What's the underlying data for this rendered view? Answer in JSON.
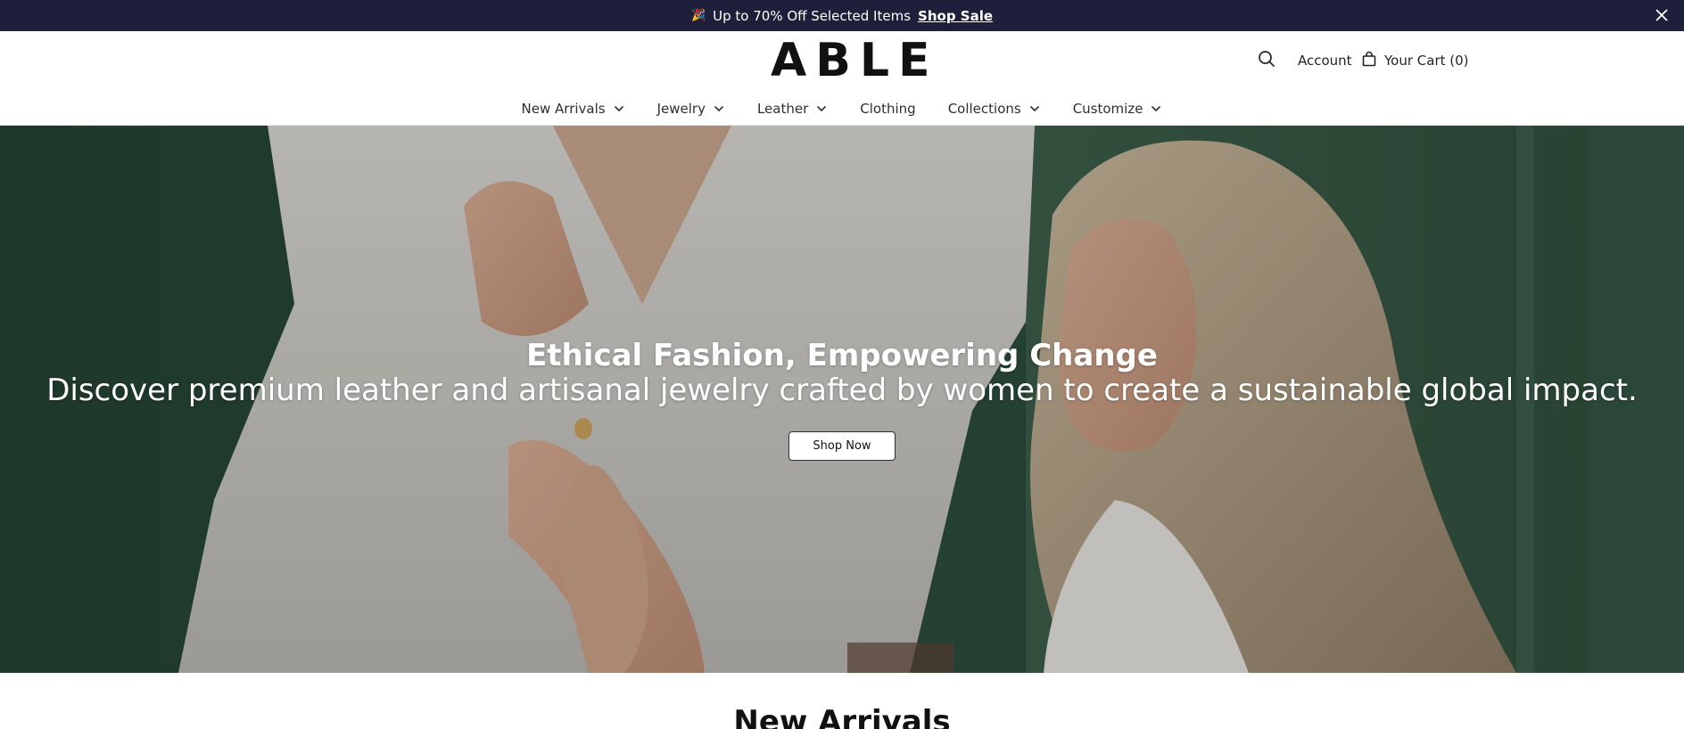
{
  "announcement": {
    "emoji": "🎉",
    "text": "Up to 70% Off Selected Items",
    "link_label": "Shop Sale"
  },
  "header": {
    "logo": "ABLE",
    "account_label": "Account",
    "cart_label": "Your Cart (0)"
  },
  "nav": {
    "items": [
      {
        "label": "New Arrivals",
        "has_dropdown": true
      },
      {
        "label": "Jewelry",
        "has_dropdown": true
      },
      {
        "label": "Leather",
        "has_dropdown": true
      },
      {
        "label": "Clothing",
        "has_dropdown": false
      },
      {
        "label": "Collections",
        "has_dropdown": true
      },
      {
        "label": "Customize",
        "has_dropdown": true
      }
    ]
  },
  "hero": {
    "title": "Ethical Fashion, Empowering Change",
    "subtitle": "Discover premium leather and artisanal jewelry crafted by women to create a sustainable global impact.",
    "cta_label": "Shop Now"
  },
  "sections": {
    "new_arrivals_title": "New Arrivals"
  },
  "colors": {
    "announcement_bg": "#1e1f3b",
    "hero_green": "#3a5a44",
    "text_dark": "#1f2328"
  },
  "icons": {
    "search": "search-icon",
    "cart": "shopping-bag-icon",
    "close": "close-icon",
    "chevron": "chevron-down-icon"
  }
}
